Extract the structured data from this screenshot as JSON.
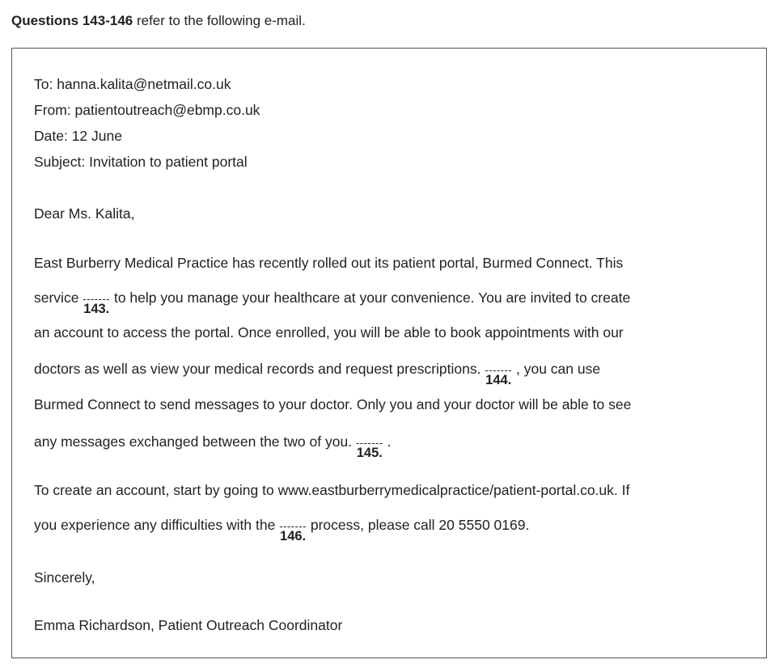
{
  "heading": {
    "bold": "Questions 143-146",
    "rest": " refer to the following e-mail."
  },
  "email": {
    "to": "To: hanna.kalita@netmail.co.uk",
    "from": "From: patientoutreach@ebmp.co.uk",
    "date": "Date: 12 June",
    "subject": "Subject: Invitation to patient portal",
    "greeting": "Dear Ms. Kalita,",
    "blank_marker": "-------",
    "p1": {
      "l1": "East Burberry Medical Practice has recently rolled out its patient portal, Burmed Connect. This",
      "l2_before": "service ",
      "q143": "143.",
      "l2_after": " to help you manage your healthcare at your convenience. You are invited to create",
      "l3": "an account to access the portal. Once enrolled, you will be able to book appointments with our",
      "l4_before": "doctors as well as view your medical records and request prescriptions. ",
      "q144": "144.",
      "l4_after": " , you can use",
      "l5": "Burmed Connect to send messages to your doctor. Only you and your doctor will be able to see",
      "l6_before": "any messages exchanged between the two of you. ",
      "q145": "145.",
      "l6_after": " ."
    },
    "p2": {
      "l1": "To create an account, start by going to www.eastburberrymedicalpractice/patient-portal.co.uk. If",
      "l2_before": "you experience any difficulties with the ",
      "q146": "146.",
      "l2_after": " process, please call 20 5550 0169."
    },
    "closing": "Sincerely,",
    "signature": "Emma Richardson, Patient Outreach Coordinator"
  }
}
